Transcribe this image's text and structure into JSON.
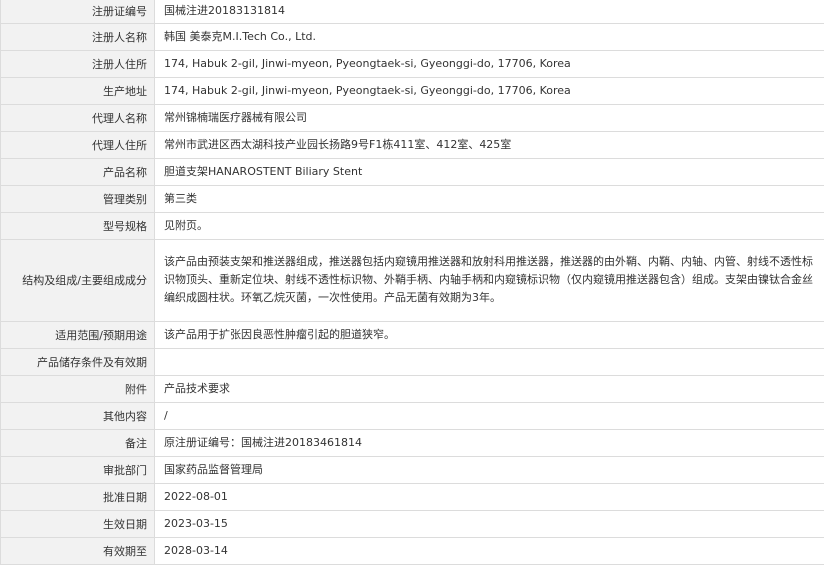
{
  "rows": [
    {
      "label": "注册证编号",
      "value": "国械注进20183131814"
    },
    {
      "label": "注册人名称",
      "value": "韩国 美泰克M.I.Tech Co., Ltd."
    },
    {
      "label": "注册人住所",
      "value": "174, Habuk 2-gil, Jinwi-myeon, Pyeongtaek-si, Gyeonggi-do, 17706, Korea"
    },
    {
      "label": "生产地址",
      "value": "174, Habuk 2-gil, Jinwi-myeon, Pyeongtaek-si, Gyeonggi-do, 17706, Korea"
    },
    {
      "label": "代理人名称",
      "value": "常州锦楠瑞医疗器械有限公司"
    },
    {
      "label": "代理人住所",
      "value": "常州市武进区西太湖科技产业园长扬路9号F1栋411室、412室、425室"
    },
    {
      "label": "产品名称",
      "value": "胆道支架HANAROSTENT Biliary Stent"
    },
    {
      "label": "管理类别",
      "value": "第三类"
    },
    {
      "label": "型号规格",
      "value": "见附页。"
    },
    {
      "label": "结构及组成/主要组成成分",
      "value": "该产品由预装支架和推送器组成，推送器包括内窥镜用推送器和放射科用推送器，推送器的由外鞘、内鞘、内轴、内管、射线不透性标识物顶头、重新定位块、射线不透性标识物、外鞘手柄、内轴手柄和内窥镜标识物（仅内窥镜用推送器包含）组成。支架由镍钛合金丝编织成圆柱状。环氧乙烷灭菌，一次性使用。产品无菌有效期为3年。"
    },
    {
      "label": "适用范围/预期用途",
      "value": "该产品用于扩张因良恶性肿瘤引起的胆道狭窄。"
    },
    {
      "label": "产品储存条件及有效期",
      "value": ""
    },
    {
      "label": "附件",
      "value": "产品技术要求"
    },
    {
      "label": "其他内容",
      "value": "/"
    },
    {
      "label": "备注",
      "value": "原注册证编号：国械注进20183461814"
    },
    {
      "label": "审批部门",
      "value": "国家药品监督管理局"
    },
    {
      "label": "批准日期",
      "value": "2022-08-01"
    },
    {
      "label": "生效日期",
      "value": "2023-03-15"
    },
    {
      "label": "有效期至",
      "value": "2028-03-14"
    }
  ]
}
